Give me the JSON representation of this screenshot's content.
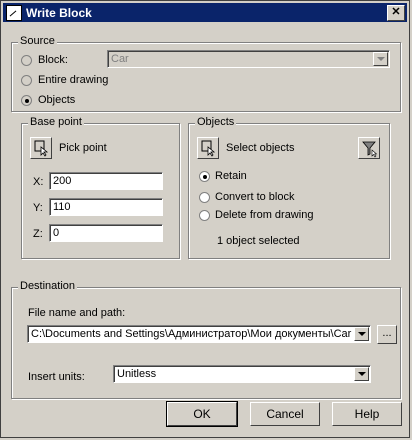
{
  "window": {
    "title": "Write Block",
    "close_glyph": "✕"
  },
  "source": {
    "legend": "Source",
    "block_label": "Block:",
    "block_value": "Car",
    "entire_label": "Entire drawing",
    "objects_label": "Objects",
    "selected": "Objects"
  },
  "base_point": {
    "legend": "Base point",
    "pick_label": "Pick point",
    "x_label": "X:",
    "x_value": "200",
    "y_label": "Y:",
    "y_value": "110",
    "z_label": "Z:",
    "z_value": "0"
  },
  "objects": {
    "legend": "Objects",
    "select_label": "Select objects",
    "retain_label": "Retain",
    "convert_label": "Convert to block",
    "delete_label": "Delete from drawing",
    "selected": "Retain",
    "status": "1 object selected"
  },
  "destination": {
    "legend": "Destination",
    "path_label": "File name and path:",
    "path_value": "C:\\Documents and Settings\\Администратор\\Мои документы\\Car",
    "browse_label": "...",
    "units_label": "Insert units:",
    "units_value": "Unitless"
  },
  "buttons": {
    "ok": "OK",
    "cancel": "Cancel",
    "help": "Help"
  }
}
